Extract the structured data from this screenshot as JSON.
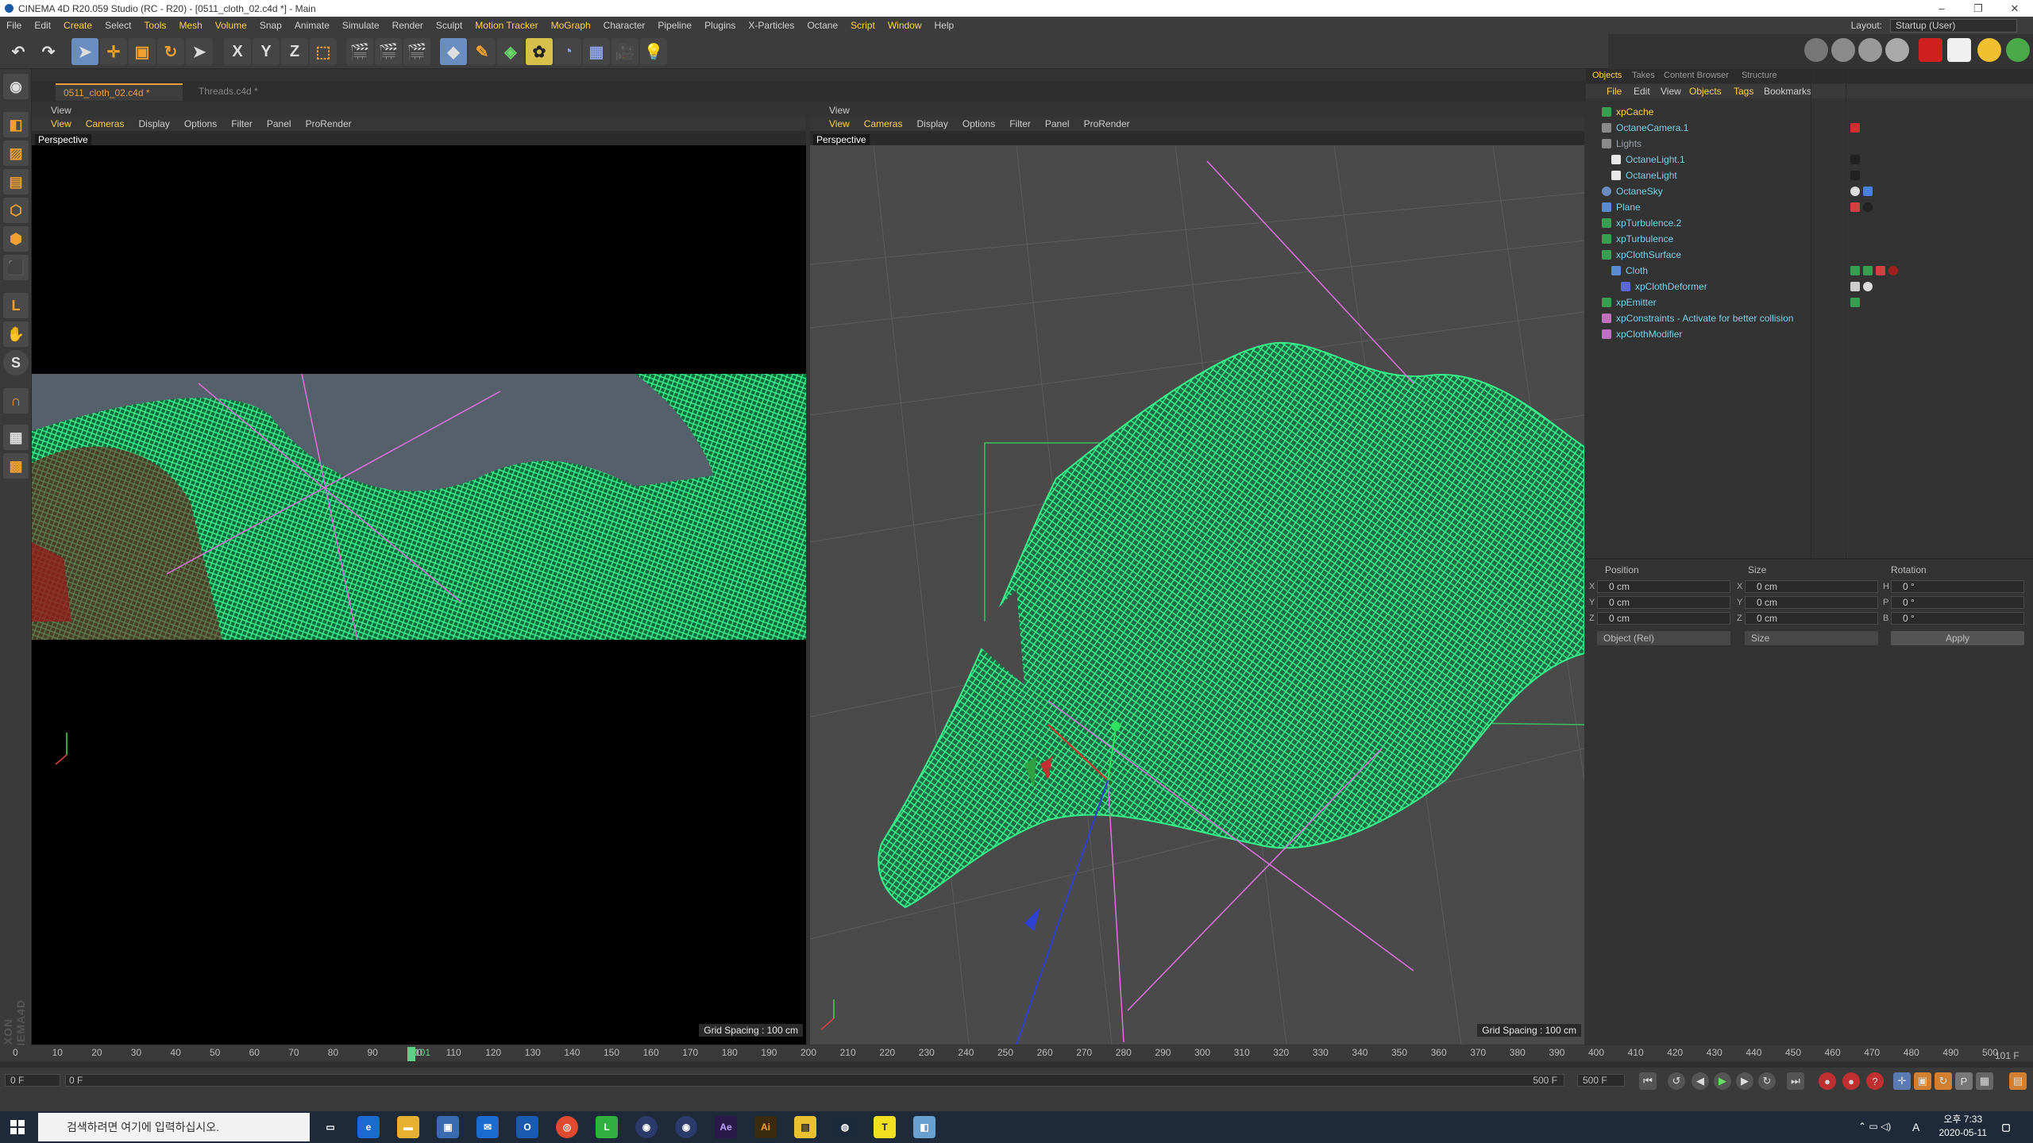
{
  "window": {
    "title": "CINEMA 4D R20.059 Studio (RC - R20) - [0511_cloth_02.c4d *] - Main",
    "controls": [
      "–",
      "❐",
      "✕"
    ]
  },
  "menubar": {
    "items": [
      "File",
      "Edit",
      "Create",
      "Select",
      "Tools",
      "Mesh",
      "Volume",
      "Snap",
      "Animate",
      "Simulate",
      "Render",
      "Sculpt",
      "Motion Tracker",
      "MoGraph",
      "Character",
      "Pipeline",
      "Plugins",
      "X-Particles",
      "Octane",
      "Script",
      "Window",
      "Help"
    ],
    "highlighted": [
      "Create",
      "Tools",
      "Mesh",
      "Volume",
      "Motion Tracker",
      "MoGraph",
      "Script",
      "Window"
    ],
    "layout_label": "Layout:",
    "layout_value": "Startup (User)"
  },
  "toolbar": {
    "axis_x": "X",
    "axis_y": "Y",
    "axis_z": "Z"
  },
  "doc_tabs": [
    {
      "label": "0511_cloth_02.c4d *"
    },
    {
      "label": "Threads.c4d *"
    }
  ],
  "viewport_left": {
    "header": "View",
    "menu": [
      "View",
      "Cameras",
      "Display",
      "Options",
      "Filter",
      "Panel",
      "ProRender"
    ],
    "label": "Perspective",
    "grid_spacing": "Grid Spacing : 100 cm"
  },
  "viewport_right": {
    "header": "View",
    "menu": [
      "View",
      "Cameras",
      "Display",
      "Options",
      "Filter",
      "Panel",
      "ProRender"
    ],
    "label": "Perspective",
    "grid_spacing": "Grid Spacing : 100 cm"
  },
  "object_manager": {
    "tabs": [
      "Objects",
      "Takes",
      "Content Browser",
      "Structure"
    ],
    "menu": [
      "File",
      "Edit",
      "View",
      "Objects",
      "Tags",
      "Bookmarks"
    ],
    "objects": [
      {
        "name": "xpCache",
        "color": "#ffd24a"
      },
      {
        "name": "OctaneCamera.1",
        "color": "#7ccfe8"
      },
      {
        "name": "Lights",
        "color": "#9aa4ad"
      },
      {
        "name": "OctaneLight.1",
        "color": "#7ccfe8"
      },
      {
        "name": "OctaneLight",
        "color": "#7ccfe8"
      },
      {
        "name": "OctaneSky",
        "color": "#7ccfe8"
      },
      {
        "name": "Plane",
        "color": "#7ccfe8"
      },
      {
        "name": "xpTurbulence.2",
        "color": "#7ccfe8"
      },
      {
        "name": "xpTurbulence",
        "color": "#7ccfe8"
      },
      {
        "name": "xpClothSurface",
        "color": "#7ccfe8"
      },
      {
        "name": "Cloth",
        "color": "#7ccfe8"
      },
      {
        "name": "xpClothDeformer",
        "color": "#7ccfe8"
      },
      {
        "name": "xpEmitter",
        "color": "#7ccfe8"
      },
      {
        "name": "xpConstraints - Activate for better collision",
        "color": "#7ccfe8"
      },
      {
        "name": "xpClothModifier",
        "color": "#7ccfe8"
      }
    ]
  },
  "attributes": {
    "headers": {
      "position": "Position",
      "size": "Size",
      "rotation": "Rotation"
    },
    "rows": [
      {
        "axis": "X",
        "pos": "0 cm",
        "size": "0 cm",
        "rot_axis": "H",
        "rot": "0 °"
      },
      {
        "axis": "Y",
        "pos": "0 cm",
        "size": "0 cm",
        "rot_axis": "P",
        "rot": "0 °"
      },
      {
        "axis": "Z",
        "pos": "0 cm",
        "size": "0 cm",
        "rot_axis": "B",
        "rot": "0 °"
      }
    ],
    "coord_mode": "Object (Rel)",
    "size_mode": "Size",
    "apply": "Apply"
  },
  "timeline": {
    "ticks": [
      "0",
      "10",
      "20",
      "30",
      "40",
      "50",
      "60",
      "70",
      "80",
      "90",
      "100",
      "110",
      "120",
      "130",
      "140",
      "150",
      "160",
      "170",
      "180",
      "190",
      "200",
      "210",
      "220",
      "230",
      "240",
      "250",
      "260",
      "270",
      "280",
      "290",
      "300",
      "310",
      "320",
      "330",
      "340",
      "350",
      "360",
      "370",
      "380",
      "390",
      "400",
      "410",
      "420",
      "430",
      "440",
      "450",
      "460",
      "470",
      "480",
      "490",
      "500"
    ],
    "current": "101",
    "current_frame_display": "101 F",
    "start": "0 F",
    "start2": "0 F",
    "end": "500 F",
    "end2": "500 F"
  },
  "taskbar": {
    "search_placeholder": "검색하려면 여기에 입력하십시오.",
    "time": "오후 7:33",
    "date": "2020-05-11",
    "lang": "A"
  }
}
